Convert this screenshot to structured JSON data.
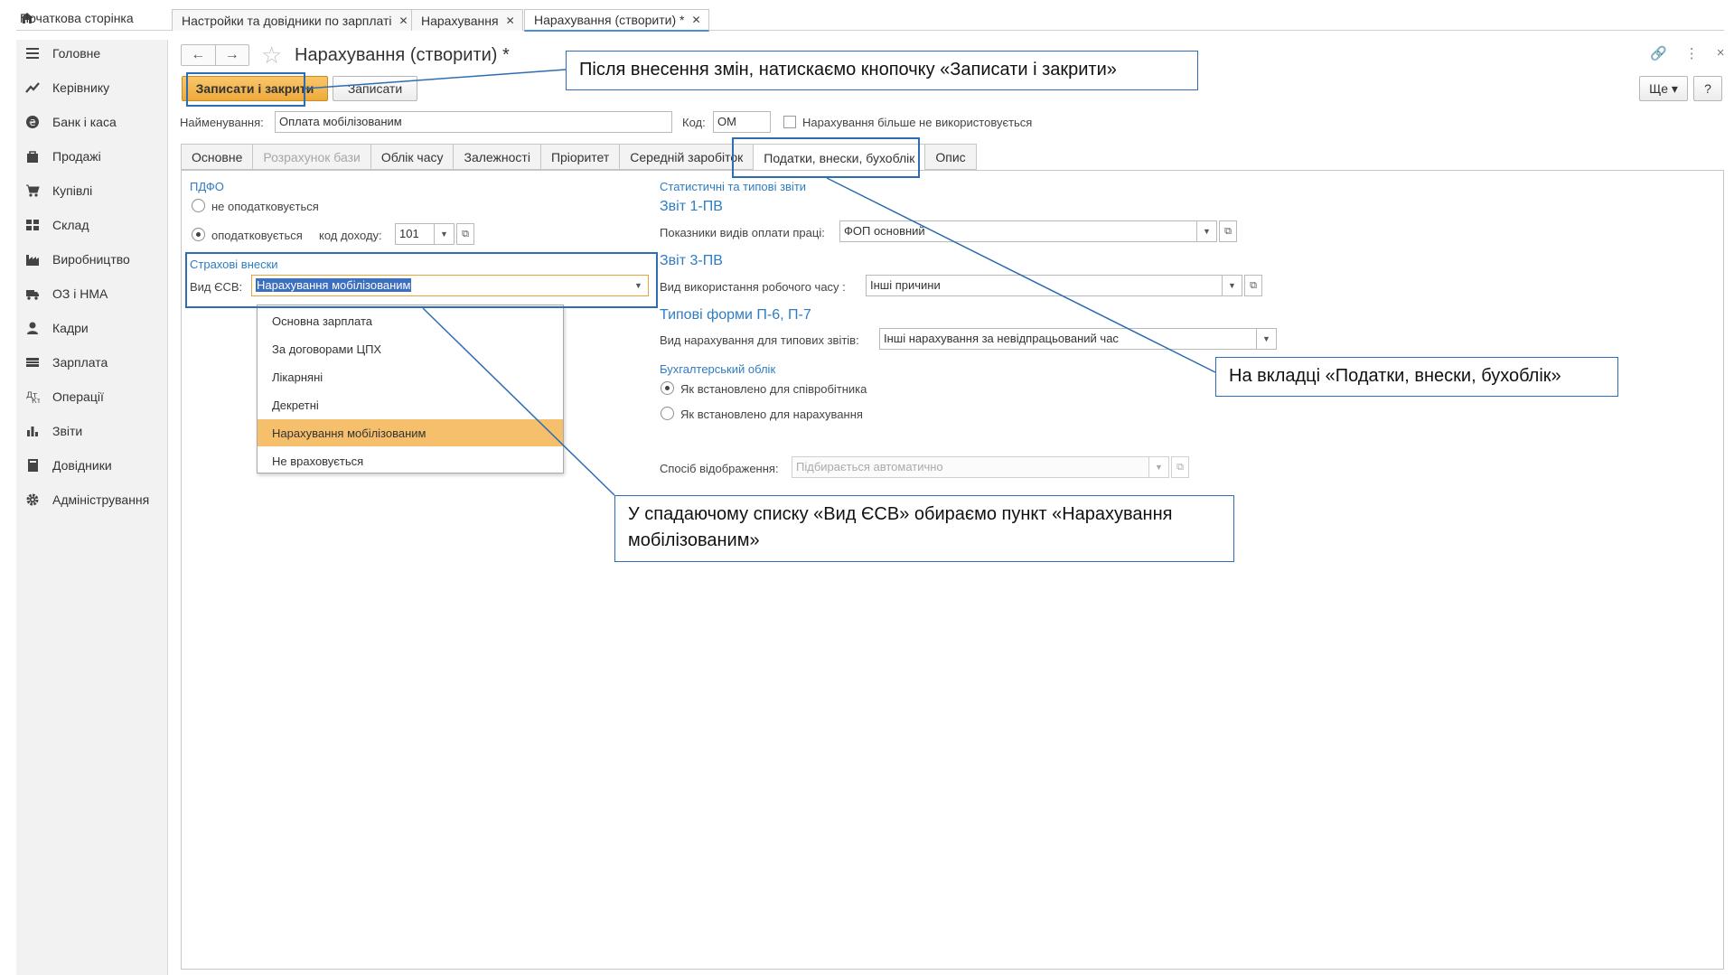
{
  "top_tabs": {
    "home": "Початкова сторінка",
    "tabs": [
      {
        "label": "Настройки та довідники по зарплаті",
        "close": "✕"
      },
      {
        "label": "Нарахування",
        "close": "✕"
      },
      {
        "label": "Нарахування (створити) *",
        "close": "✕"
      }
    ]
  },
  "sidebar": {
    "items": [
      {
        "label": "Головне",
        "icon": "menu-icon"
      },
      {
        "label": "Керівнику",
        "icon": "chart-line-icon"
      },
      {
        "label": "Банк і каса",
        "icon": "currency-icon"
      },
      {
        "label": "Продажі",
        "icon": "bag-icon"
      },
      {
        "label": "Купівлі",
        "icon": "cart-icon"
      },
      {
        "label": "Склад",
        "icon": "warehouse-icon"
      },
      {
        "label": "Виробництво",
        "icon": "factory-icon"
      },
      {
        "label": "ОЗ і НМА",
        "icon": "truck-icon"
      },
      {
        "label": "Кадри",
        "icon": "person-icon"
      },
      {
        "label": "Зарплата",
        "icon": "wallet-icon"
      },
      {
        "label": "Операції",
        "icon": "operations-icon"
      },
      {
        "label": "Звіти",
        "icon": "bar-chart-icon"
      },
      {
        "label": "Довідники",
        "icon": "book-icon"
      },
      {
        "label": "Адміністрування",
        "icon": "gear-icon"
      }
    ]
  },
  "form": {
    "title": "Нарахування (створити) *",
    "nav_back": "←",
    "nav_forward": "→",
    "star": "☆",
    "icons": {
      "link": "🔗",
      "more": "⋮",
      "close": "×"
    },
    "buttons": {
      "save_close": "Записати і закрити",
      "save": "Записати",
      "more": "Ще ▾",
      "help": "?"
    },
    "name_label": "Найменування:",
    "name_value": "Оплата мобілізованим",
    "code_label": "Код:",
    "code_value": "ОМ",
    "not_used_label": "Нарахування більше не використовується",
    "tabs": [
      {
        "label": "Основне"
      },
      {
        "label": "Розрахунок бази"
      },
      {
        "label": "Облік часу"
      },
      {
        "label": "Залежності"
      },
      {
        "label": "Пріоритет"
      },
      {
        "label": "Середній заробіток"
      },
      {
        "label": "Податки, внески, бухоблік"
      },
      {
        "label": "Опис"
      }
    ]
  },
  "tax_tab": {
    "pdfo": {
      "title": "ПДФО",
      "not_taxed": "не оподатковується",
      "taxed": "оподатковується",
      "income_code_label": "код доходу:",
      "income_code_value": "101"
    },
    "insurance": {
      "title": "Страхові внески",
      "esv_label": "Вид ЄСВ:",
      "esv_value": "Нарахування мобілізованим",
      "options": [
        "Основна зарплата",
        "За договорами ЦПХ",
        "Лікарняні",
        "Декретні",
        "Нарахування мобілізованим",
        "Не враховується"
      ],
      "selected_option": "Нарахування мобілізованим"
    },
    "stats": {
      "title": "Статистичні та типові звіти",
      "report_1pv": "Звіт 1-ПВ",
      "pay_kind_label": "Показники видів оплати праці:",
      "pay_kind_value": "ФОП основний",
      "report_3pv": "Звіт 3-ПВ",
      "work_time_label": "Вид використання робочого часу :",
      "work_time_value": "Інші причини",
      "typical_forms": "Типові форми П-6, П-7",
      "accrual_kind_label": "Вид нарахування для типових звітів:",
      "accrual_kind_value": "Інші нарахування за невідпрацьований час"
    },
    "accounting": {
      "title": "Бухгалтерський облік",
      "as_employee": "Як встановлено для співробітника",
      "as_accrual": "Як встановлено для нарахування",
      "display_label": "Спосіб відображення:",
      "display_placeholder": "Підбирається автоматично"
    }
  },
  "callouts": {
    "save": "Після внесення змін, натискаємо кнопочку «Записати і закрити»",
    "tab": "На вкладці «Податки, внески, бухоблік»",
    "dropdown": "У спадаючому списку «Вид ЄСВ» обираємо пункт «Нарахування мобілізованим»"
  },
  "colors": {
    "primary_button": "#eeaa3c",
    "selected_row": "#f6bf6c",
    "annotation": "#2d6db3",
    "group_title": "#2f7cc2"
  }
}
